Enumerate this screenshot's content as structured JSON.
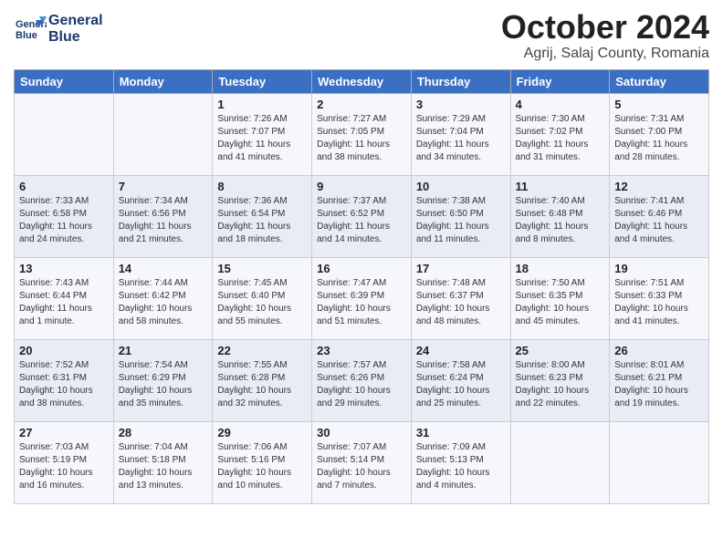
{
  "header": {
    "logo_line1": "General",
    "logo_line2": "Blue",
    "month": "October 2024",
    "location": "Agrij, Salaj County, Romania"
  },
  "days_of_week": [
    "Sunday",
    "Monday",
    "Tuesday",
    "Wednesday",
    "Thursday",
    "Friday",
    "Saturday"
  ],
  "weeks": [
    [
      {
        "day": "",
        "info": ""
      },
      {
        "day": "",
        "info": ""
      },
      {
        "day": "1",
        "sunrise": "Sunrise: 7:26 AM",
        "sunset": "Sunset: 7:07 PM",
        "daylight": "Daylight: 11 hours and 41 minutes."
      },
      {
        "day": "2",
        "sunrise": "Sunrise: 7:27 AM",
        "sunset": "Sunset: 7:05 PM",
        "daylight": "Daylight: 11 hours and 38 minutes."
      },
      {
        "day": "3",
        "sunrise": "Sunrise: 7:29 AM",
        "sunset": "Sunset: 7:04 PM",
        "daylight": "Daylight: 11 hours and 34 minutes."
      },
      {
        "day": "4",
        "sunrise": "Sunrise: 7:30 AM",
        "sunset": "Sunset: 7:02 PM",
        "daylight": "Daylight: 11 hours and 31 minutes."
      },
      {
        "day": "5",
        "sunrise": "Sunrise: 7:31 AM",
        "sunset": "Sunset: 7:00 PM",
        "daylight": "Daylight: 11 hours and 28 minutes."
      }
    ],
    [
      {
        "day": "6",
        "sunrise": "Sunrise: 7:33 AM",
        "sunset": "Sunset: 6:58 PM",
        "daylight": "Daylight: 11 hours and 24 minutes."
      },
      {
        "day": "7",
        "sunrise": "Sunrise: 7:34 AM",
        "sunset": "Sunset: 6:56 PM",
        "daylight": "Daylight: 11 hours and 21 minutes."
      },
      {
        "day": "8",
        "sunrise": "Sunrise: 7:36 AM",
        "sunset": "Sunset: 6:54 PM",
        "daylight": "Daylight: 11 hours and 18 minutes."
      },
      {
        "day": "9",
        "sunrise": "Sunrise: 7:37 AM",
        "sunset": "Sunset: 6:52 PM",
        "daylight": "Daylight: 11 hours and 14 minutes."
      },
      {
        "day": "10",
        "sunrise": "Sunrise: 7:38 AM",
        "sunset": "Sunset: 6:50 PM",
        "daylight": "Daylight: 11 hours and 11 minutes."
      },
      {
        "day": "11",
        "sunrise": "Sunrise: 7:40 AM",
        "sunset": "Sunset: 6:48 PM",
        "daylight": "Daylight: 11 hours and 8 minutes."
      },
      {
        "day": "12",
        "sunrise": "Sunrise: 7:41 AM",
        "sunset": "Sunset: 6:46 PM",
        "daylight": "Daylight: 11 hours and 4 minutes."
      }
    ],
    [
      {
        "day": "13",
        "sunrise": "Sunrise: 7:43 AM",
        "sunset": "Sunset: 6:44 PM",
        "daylight": "Daylight: 11 hours and 1 minute."
      },
      {
        "day": "14",
        "sunrise": "Sunrise: 7:44 AM",
        "sunset": "Sunset: 6:42 PM",
        "daylight": "Daylight: 10 hours and 58 minutes."
      },
      {
        "day": "15",
        "sunrise": "Sunrise: 7:45 AM",
        "sunset": "Sunset: 6:40 PM",
        "daylight": "Daylight: 10 hours and 55 minutes."
      },
      {
        "day": "16",
        "sunrise": "Sunrise: 7:47 AM",
        "sunset": "Sunset: 6:39 PM",
        "daylight": "Daylight: 10 hours and 51 minutes."
      },
      {
        "day": "17",
        "sunrise": "Sunrise: 7:48 AM",
        "sunset": "Sunset: 6:37 PM",
        "daylight": "Daylight: 10 hours and 48 minutes."
      },
      {
        "day": "18",
        "sunrise": "Sunrise: 7:50 AM",
        "sunset": "Sunset: 6:35 PM",
        "daylight": "Daylight: 10 hours and 45 minutes."
      },
      {
        "day": "19",
        "sunrise": "Sunrise: 7:51 AM",
        "sunset": "Sunset: 6:33 PM",
        "daylight": "Daylight: 10 hours and 41 minutes."
      }
    ],
    [
      {
        "day": "20",
        "sunrise": "Sunrise: 7:52 AM",
        "sunset": "Sunset: 6:31 PM",
        "daylight": "Daylight: 10 hours and 38 minutes."
      },
      {
        "day": "21",
        "sunrise": "Sunrise: 7:54 AM",
        "sunset": "Sunset: 6:29 PM",
        "daylight": "Daylight: 10 hours and 35 minutes."
      },
      {
        "day": "22",
        "sunrise": "Sunrise: 7:55 AM",
        "sunset": "Sunset: 6:28 PM",
        "daylight": "Daylight: 10 hours and 32 minutes."
      },
      {
        "day": "23",
        "sunrise": "Sunrise: 7:57 AM",
        "sunset": "Sunset: 6:26 PM",
        "daylight": "Daylight: 10 hours and 29 minutes."
      },
      {
        "day": "24",
        "sunrise": "Sunrise: 7:58 AM",
        "sunset": "Sunset: 6:24 PM",
        "daylight": "Daylight: 10 hours and 25 minutes."
      },
      {
        "day": "25",
        "sunrise": "Sunrise: 8:00 AM",
        "sunset": "Sunset: 6:23 PM",
        "daylight": "Daylight: 10 hours and 22 minutes."
      },
      {
        "day": "26",
        "sunrise": "Sunrise: 8:01 AM",
        "sunset": "Sunset: 6:21 PM",
        "daylight": "Daylight: 10 hours and 19 minutes."
      }
    ],
    [
      {
        "day": "27",
        "sunrise": "Sunrise: 7:03 AM",
        "sunset": "Sunset: 5:19 PM",
        "daylight": "Daylight: 10 hours and 16 minutes."
      },
      {
        "day": "28",
        "sunrise": "Sunrise: 7:04 AM",
        "sunset": "Sunset: 5:18 PM",
        "daylight": "Daylight: 10 hours and 13 minutes."
      },
      {
        "day": "29",
        "sunrise": "Sunrise: 7:06 AM",
        "sunset": "Sunset: 5:16 PM",
        "daylight": "Daylight: 10 hours and 10 minutes."
      },
      {
        "day": "30",
        "sunrise": "Sunrise: 7:07 AM",
        "sunset": "Sunset: 5:14 PM",
        "daylight": "Daylight: 10 hours and 7 minutes."
      },
      {
        "day": "31",
        "sunrise": "Sunrise: 7:09 AM",
        "sunset": "Sunset: 5:13 PM",
        "daylight": "Daylight: 10 hours and 4 minutes."
      },
      {
        "day": "",
        "info": ""
      },
      {
        "day": "",
        "info": ""
      }
    ]
  ]
}
